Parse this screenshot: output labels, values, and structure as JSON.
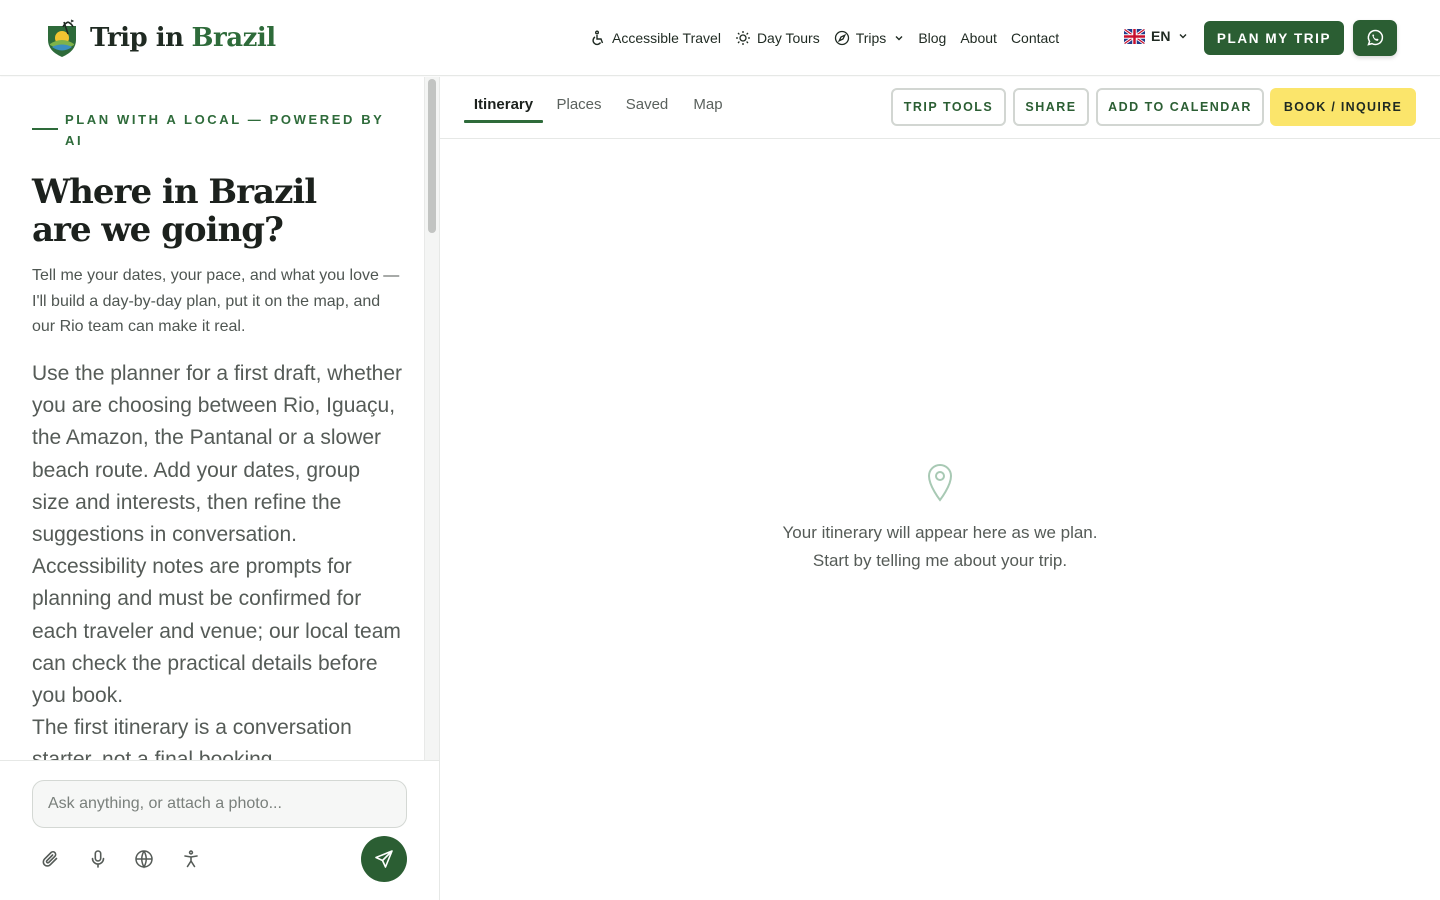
{
  "header": {
    "brand_part1": "Trip in",
    "brand_part2": "Brazil",
    "nav": [
      {
        "label": "Accessible Travel",
        "icon": "accessibility-icon"
      },
      {
        "label": "Day Tours",
        "icon": "sun-icon"
      },
      {
        "label": "Trips",
        "icon": "compass-icon",
        "dropdown": true
      },
      {
        "label": "Blog"
      },
      {
        "label": "About"
      },
      {
        "label": "Contact"
      }
    ],
    "language": "EN",
    "plan_button": "PLAN MY TRIP",
    "whatsapp_icon": "whatsapp-icon"
  },
  "left": {
    "eyebrow": "PLAN WITH A LOCAL — POWERED BY AI",
    "headline_line1": "Where in Brazil",
    "headline_line2": "are we going?",
    "intro": "Tell me your dates, your pace, and what you love — I'll build a day-by-day plan, put it on the map, and our Rio team can make it real.",
    "body_p1": "Use the planner for a first draft, whether you are choosing between Rio, Iguaçu, the Amazon, the Pantanal or a slower beach route. Add your dates, group size and interests, then refine the suggestions in conversation. Accessibility notes are prompts for planning and must be confirmed for each traveler and venue; our local team can check the practical details before you book.",
    "body_p2": "The first itinerary is a conversation starter, not a final booking."
  },
  "composer": {
    "placeholder": "Ask anything, or attach a photo...",
    "tools": [
      "paperclip-icon",
      "microphone-icon",
      "globe-icon",
      "accessibility-icon"
    ],
    "send_icon": "send-icon"
  },
  "right": {
    "tabs": [
      "Itinerary",
      "Places",
      "Saved",
      "Map"
    ],
    "active_tab": "Itinerary",
    "buttons": {
      "trip_tools": "TRIP TOOLS",
      "share": "SHARE",
      "calendar": "ADD TO CALENDAR",
      "book": "BOOK / INQUIRE"
    },
    "empty_line1": "Your itinerary will appear here as we plan.",
    "empty_line2": "Start by telling me about your trip."
  },
  "colors": {
    "brand_green": "#2b5e33",
    "accent_yellow": "#fbe56b"
  }
}
